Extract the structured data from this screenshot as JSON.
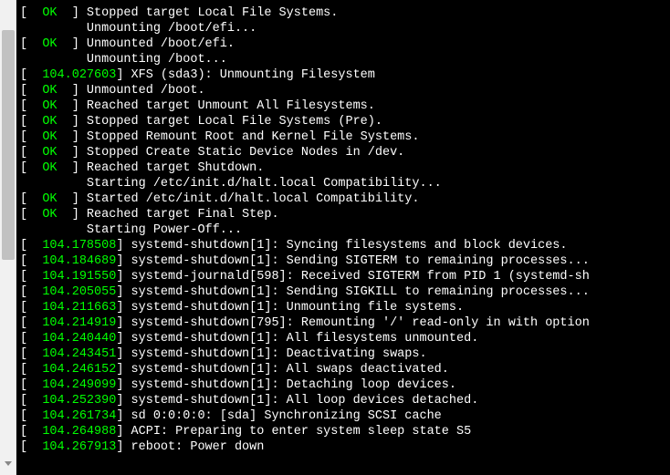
{
  "lines": [
    {
      "type": "status",
      "status": "OK",
      "msg": "Stopped target Local File Systems."
    },
    {
      "type": "sub",
      "text": "Unmounting /boot/efi..."
    },
    {
      "type": "status",
      "status": "OK",
      "msg": "Unmounted /boot/efi."
    },
    {
      "type": "sub",
      "text": "Unmounting /boot..."
    },
    {
      "type": "ts",
      "ts": "104.027603",
      "msg": "XFS (sda3): Unmounting Filesystem"
    },
    {
      "type": "status",
      "status": "OK",
      "msg": "Unmounted /boot."
    },
    {
      "type": "status",
      "status": "OK",
      "msg": "Reached target Unmount All Filesystems."
    },
    {
      "type": "status",
      "status": "OK",
      "msg": "Stopped target Local File Systems (Pre)."
    },
    {
      "type": "status",
      "status": "OK",
      "msg": "Stopped Remount Root and Kernel File Systems."
    },
    {
      "type": "status",
      "status": "OK",
      "msg": "Stopped Create Static Device Nodes in /dev."
    },
    {
      "type": "status",
      "status": "OK",
      "msg": "Reached target Shutdown."
    },
    {
      "type": "sub",
      "text": "Starting /etc/init.d/halt.local Compatibility..."
    },
    {
      "type": "status",
      "status": "OK",
      "msg": "Started /etc/init.d/halt.local Compatibility."
    },
    {
      "type": "status",
      "status": "OK",
      "msg": "Reached target Final Step."
    },
    {
      "type": "sub",
      "text": "Starting Power-Off..."
    },
    {
      "type": "ts",
      "ts": "104.178508",
      "msg": "systemd-shutdown[1]: Syncing filesystems and block devices."
    },
    {
      "type": "ts",
      "ts": "104.184689",
      "msg": "systemd-shutdown[1]: Sending SIGTERM to remaining processes..."
    },
    {
      "type": "ts",
      "ts": "104.191550",
      "msg": "systemd-journald[598]: Received SIGTERM from PID 1 (systemd-sh"
    },
    {
      "type": "ts",
      "ts": "104.205055",
      "msg": "systemd-shutdown[1]: Sending SIGKILL to remaining processes..."
    },
    {
      "type": "ts",
      "ts": "104.211663",
      "msg": "systemd-shutdown[1]: Unmounting file systems."
    },
    {
      "type": "ts",
      "ts": "104.214919",
      "msg": "systemd-shutdown[795]: Remounting '/' read-only in with option"
    },
    {
      "type": "ts",
      "ts": "104.240440",
      "msg": "systemd-shutdown[1]: All filesystems unmounted."
    },
    {
      "type": "ts",
      "ts": "104.243451",
      "msg": "systemd-shutdown[1]: Deactivating swaps."
    },
    {
      "type": "ts",
      "ts": "104.246152",
      "msg": "systemd-shutdown[1]: All swaps deactivated."
    },
    {
      "type": "ts",
      "ts": "104.249099",
      "msg": "systemd-shutdown[1]: Detaching loop devices."
    },
    {
      "type": "ts",
      "ts": "104.252390",
      "msg": "systemd-shutdown[1]: All loop devices detached."
    },
    {
      "type": "ts",
      "ts": "104.261734",
      "msg": "sd 0:0:0:0: [sda] Synchronizing SCSI cache"
    },
    {
      "type": "ts",
      "ts": "104.264988",
      "msg": "ACPI: Preparing to enter system sleep state S5"
    },
    {
      "type": "ts",
      "ts": "104.267913",
      "msg": "reboot: Power down"
    }
  ]
}
